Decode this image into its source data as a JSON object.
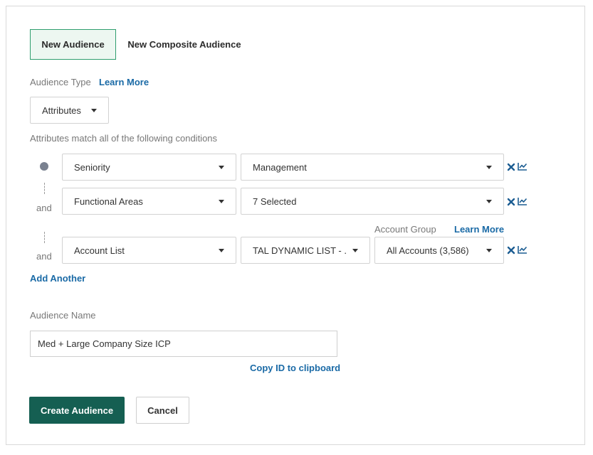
{
  "tabs": {
    "new_audience": "New Audience",
    "new_composite": "New Composite Audience"
  },
  "audience_type": {
    "label": "Audience Type",
    "learn_more": "Learn More",
    "selected": "Attributes"
  },
  "conditions": {
    "heading": "Attributes match all of the following conditions",
    "connector": "and",
    "rows": [
      {
        "attribute": "Seniority",
        "value": "Management"
      },
      {
        "attribute": "Functional Areas",
        "value": "7 Selected"
      },
      {
        "attribute": "Account List",
        "value": "TAL DYNAMIC LIST - ...",
        "group_value": "All Accounts (3,586)"
      }
    ],
    "account_group_label": "Account Group",
    "account_group_learn_more": "Learn More",
    "add_another": "Add Another"
  },
  "audience_name": {
    "label": "Audience Name",
    "value": "Med + Large Company Size ICP",
    "copy_id": "Copy ID to clipboard"
  },
  "actions": {
    "create": "Create Audience",
    "cancel": "Cancel"
  },
  "colors": {
    "accent_green": "#155f52",
    "tab_border": "#2f9e6e",
    "link_blue": "#1a6aa6",
    "icon_blue": "#1c5d92"
  }
}
